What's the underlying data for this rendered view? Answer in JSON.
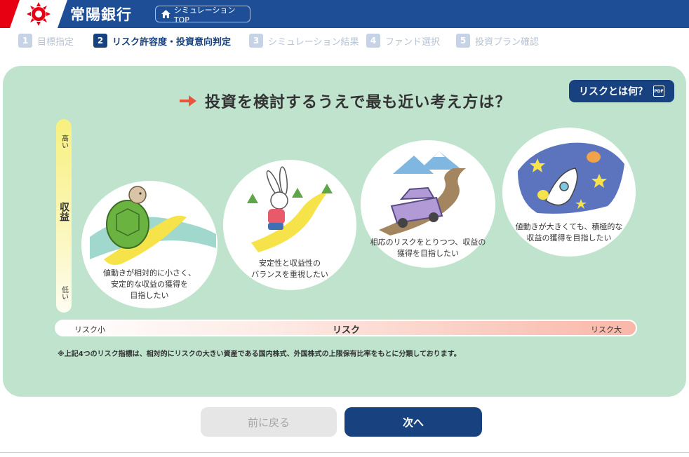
{
  "header": {
    "brand": "常陽銀行",
    "top_button": "シミュレーションTOP",
    "colors": {
      "brand_blue": "#1e4f96",
      "logo_red": "#e60012"
    }
  },
  "steps": [
    {
      "num": "1",
      "label": "目標指定",
      "state": "inactive"
    },
    {
      "num": "2",
      "label": "リスク許容度・投資意向判定",
      "state": "active"
    },
    {
      "num": "3",
      "label": "シミュレーション結果",
      "state": "inactive"
    },
    {
      "num": "4",
      "label": "ファンド選択",
      "state": "inactive"
    },
    {
      "num": "5",
      "label": "投資プラン確認",
      "state": "inactive"
    }
  ],
  "question": {
    "text": "投資を検討するうえで最も近い考え方は？",
    "arrow_icon": "right-arrow-icon"
  },
  "risk_button": {
    "label": "リスクとは何？",
    "icon": "pdf-icon",
    "icon_text": "PDF"
  },
  "return_axis": {
    "high": "高い",
    "label": "収益",
    "low": "低い"
  },
  "options": [
    {
      "illustration": "turtle",
      "text": [
        "値動きが相対的に小さく、",
        "安定的な収益の獲得を",
        "目指したい"
      ]
    },
    {
      "illustration": "rabbit",
      "text": [
        "安定性と収益性の",
        "バランスを重視したい"
      ]
    },
    {
      "illustration": "car",
      "text": [
        "相応のリスクをとりつつ、収益の",
        "獲得を目指したい"
      ]
    },
    {
      "illustration": "rocket",
      "text": [
        "値動きが大きくても、積極的な",
        "収益の獲得を目指したい"
      ]
    }
  ],
  "risk_axis": {
    "low": "リスク小",
    "label": "リスク",
    "high": "リスク大"
  },
  "note": "※上記4つのリスク指標は、相対的にリスクの大きい資産である国内株式、外国株式の上限保有比率をもとに分類しております。",
  "buttons": {
    "back": "前に戻る",
    "next": "次へ"
  }
}
